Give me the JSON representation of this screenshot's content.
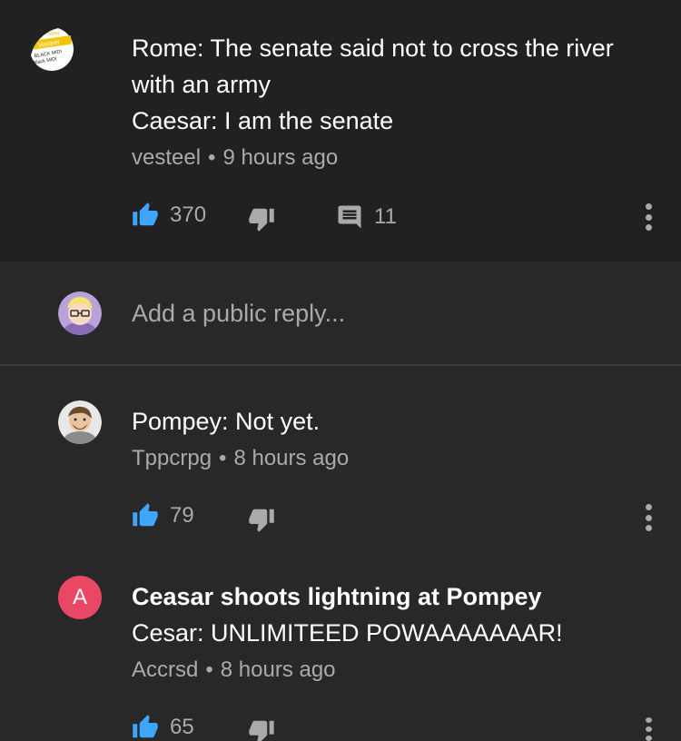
{
  "comments": [
    {
      "avatar_icon": "vesteel-logo-avatar",
      "avatar_text": [
        "Vesteel",
        "Vesteel",
        "BLACK MIDI",
        "Black MIDI"
      ],
      "lines": [
        "Rome: The senate said not to cross the river",
        "with an army",
        "Caesar: I am the senate"
      ],
      "author": "vesteel",
      "time": "9 hours ago",
      "likes": "370",
      "replies": "11"
    },
    {
      "avatar_icon": "pompey-avatar",
      "lines": [
        "Pompey: Not yet."
      ],
      "author": "Tppcrpg",
      "time": "8 hours ago",
      "likes": "79"
    },
    {
      "avatar_letter": "A",
      "avatar_color": "#e84864",
      "lines": [
        "Ceasar shoots lightning at Pompey",
        "Cesar: UNLIMITEED POWAAAAAAAR!"
      ],
      "author": "Accrsd",
      "time": "8 hours ago",
      "likes": "65"
    }
  ],
  "reply_box": {
    "placeholder": "Add a public reply..."
  },
  "separator": "•",
  "colors": {
    "like_blue": "#3ea6ff",
    "icon_grey": "#aaaaaa",
    "main_bg": "#212121",
    "reply_bg": "#282828"
  }
}
